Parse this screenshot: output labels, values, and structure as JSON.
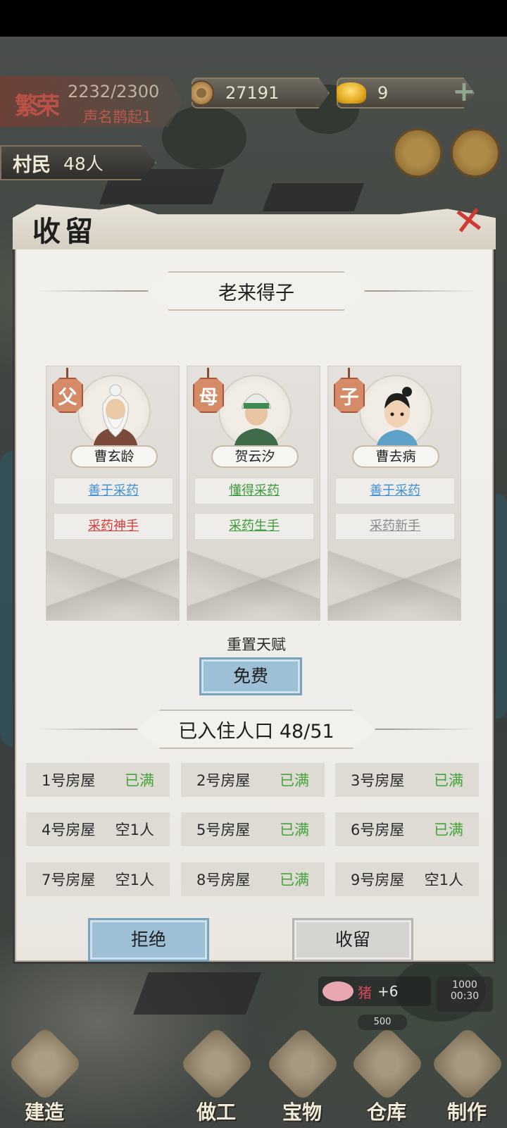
{
  "hud": {
    "prestige_rank": "繁荣",
    "prestige_value": "2232/2300",
    "prestige_sub": "声名鹊起1",
    "coins": "27191",
    "gold": "9",
    "villagers_label": "村民",
    "villagers_count": "48人"
  },
  "modal": {
    "title": "收留",
    "event_title": "老来得子",
    "family": [
      {
        "role": "父",
        "name": "曹玄龄",
        "traits": [
          {
            "text": "善于采药",
            "color": "#3f8fd6"
          },
          {
            "text": "采药神手",
            "color": "#d83a3a"
          }
        ]
      },
      {
        "role": "母",
        "name": "贺云汐",
        "traits": [
          {
            "text": "懂得采药",
            "color": "#3c9a3c"
          },
          {
            "text": "采药生手",
            "color": "#3c9a3c"
          }
        ]
      },
      {
        "role": "子",
        "name": "曹去病",
        "traits": [
          {
            "text": "善于采药",
            "color": "#3f8fd6"
          },
          {
            "text": "采药新手",
            "color": "#8a8a8a"
          }
        ]
      }
    ],
    "reset_label": "重置天赋",
    "free_button": "免费",
    "population_label": "已入住人口 48/51",
    "houses": [
      {
        "name": "1号房屋",
        "status": "已满",
        "full": true
      },
      {
        "name": "2号房屋",
        "status": "已满",
        "full": true
      },
      {
        "name": "3号房屋",
        "status": "已满",
        "full": true
      },
      {
        "name": "4号房屋",
        "status": "空1人",
        "full": false
      },
      {
        "name": "5号房屋",
        "status": "已满",
        "full": true
      },
      {
        "name": "6号房屋",
        "status": "已满",
        "full": true
      },
      {
        "name": "7号房屋",
        "status": "空1人",
        "full": false
      },
      {
        "name": "8号房屋",
        "status": "已满",
        "full": true
      },
      {
        "name": "9号房屋",
        "status": "空1人",
        "full": false
      }
    ],
    "reject_button": "拒绝",
    "accept_button": "收留"
  },
  "notice": {
    "pig_name": "猪",
    "pig_delta": "+6",
    "timer_price": "1000",
    "timer": "00:30",
    "price": "500"
  },
  "bottom_nav": [
    {
      "label": "建造",
      "icon": "build-icon"
    },
    {
      "label": "做工",
      "icon": "work-icon"
    },
    {
      "label": "宝物",
      "icon": "treasure-icon"
    },
    {
      "label": "仓库",
      "icon": "warehouse-icon"
    },
    {
      "label": "制作",
      "icon": "craft-icon"
    }
  ]
}
